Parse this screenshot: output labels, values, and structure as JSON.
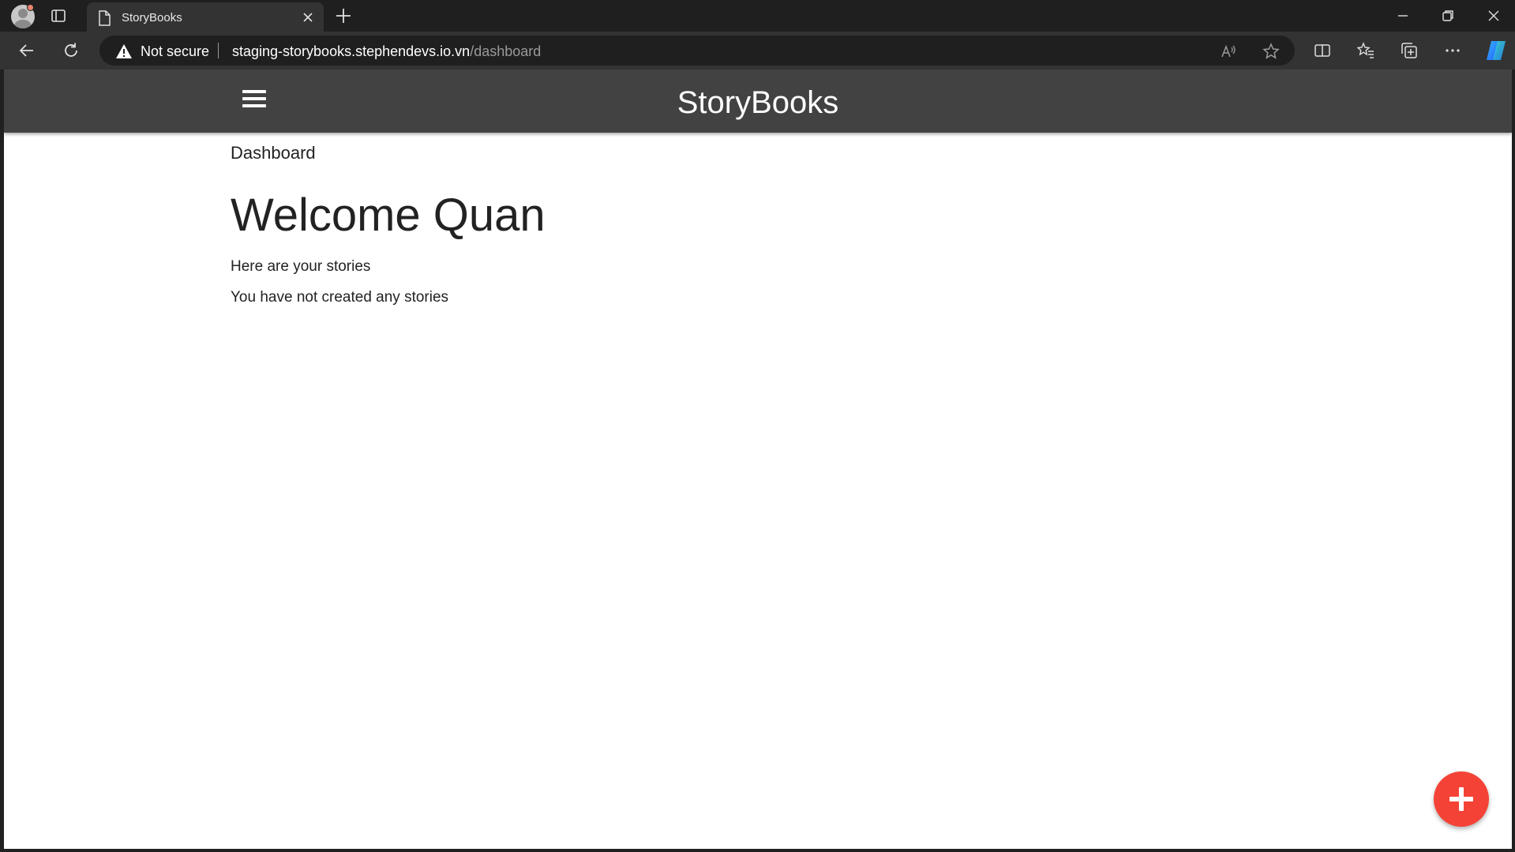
{
  "browser": {
    "tab_title": "StoryBooks",
    "security_label": "Not secure",
    "url_host": "staging-storybooks.stephendevs.io.vn",
    "url_path": "/dashboard",
    "icons": [
      "profile-avatar-icon",
      "tab-actions-icon",
      "page-icon",
      "close-icon",
      "plus-icon",
      "minimize-icon",
      "restore-icon",
      "window-close-icon",
      "back-arrow-icon",
      "refresh-icon",
      "warning-icon",
      "read-aloud-icon",
      "favorite-star-icon",
      "split-screen-icon",
      "favorites-icon",
      "collections-icon",
      "more-icon",
      "copilot-icon"
    ]
  },
  "app": {
    "brand": "StoryBooks",
    "accent_color": "#f44336",
    "appbar_color": "#424242"
  },
  "page": {
    "breadcrumb": "Dashboard",
    "welcome": "Welcome Quan",
    "subtitle": "Here are your stories",
    "empty_message": "You have not created any stories"
  }
}
